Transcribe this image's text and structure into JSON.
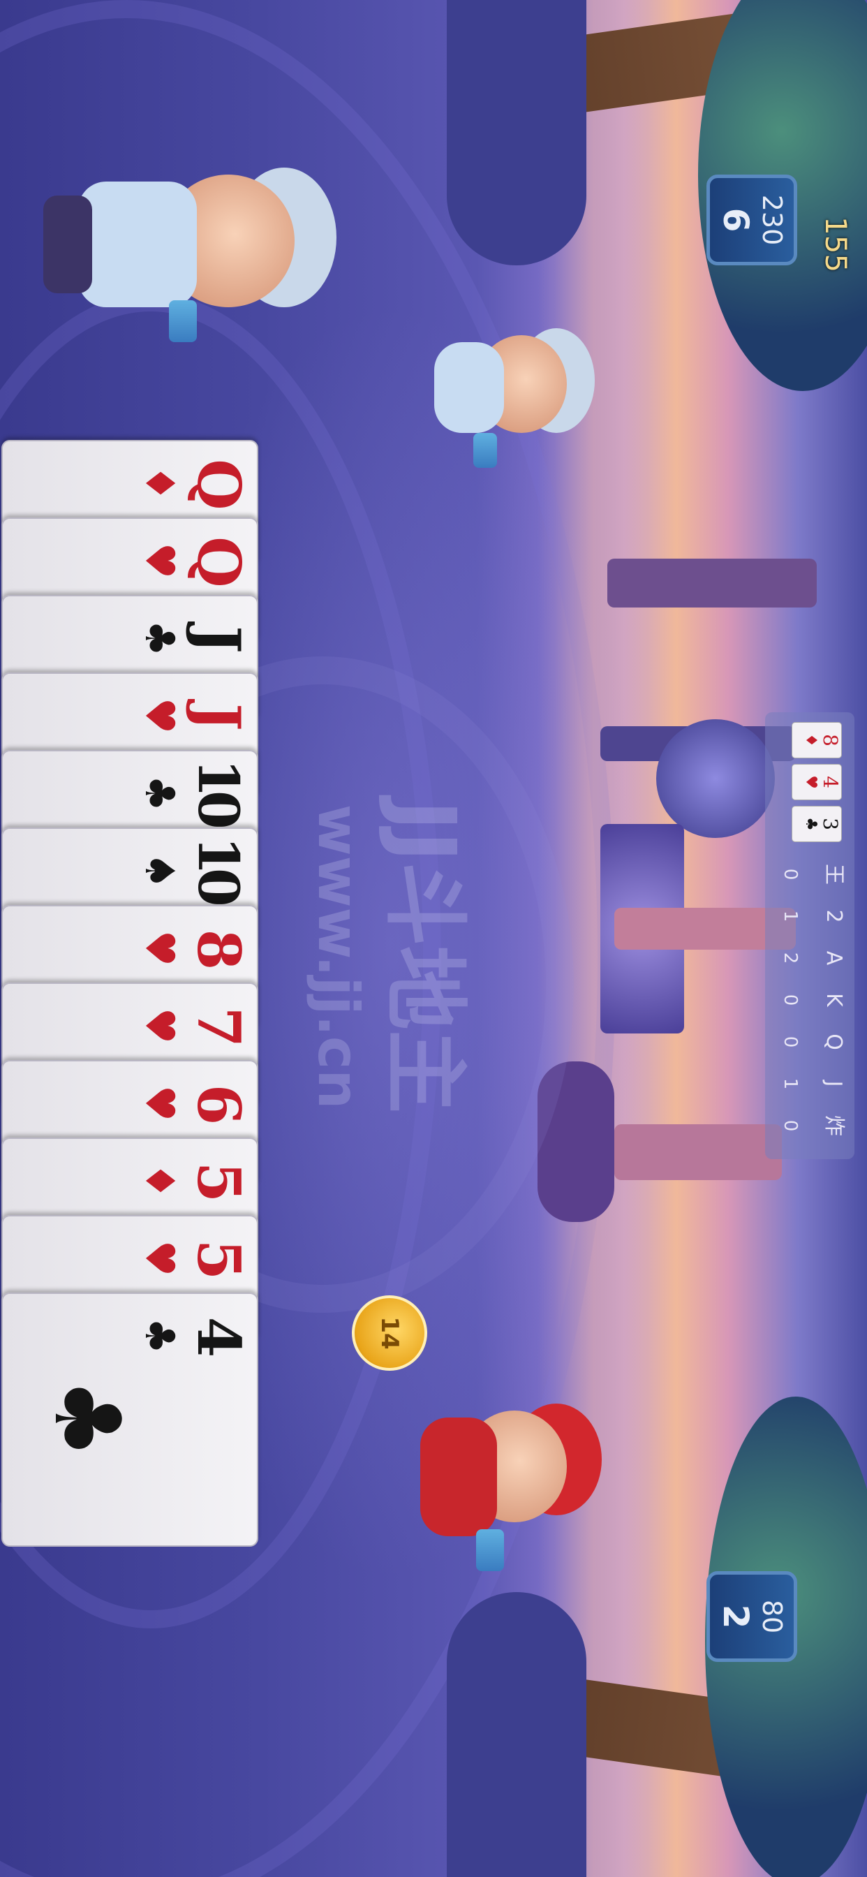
{
  "game": {
    "watermark_title": "JJ斗地主",
    "watermark_url": "www.jj.cn"
  },
  "player_coins": "155",
  "opponents": [
    {
      "name": "top-opponent",
      "score": "230",
      "cards_left": "6"
    },
    {
      "name": "bottom-opponent",
      "score": "80",
      "cards_left": "2"
    }
  ],
  "turn_timer": "14",
  "card_tracker": {
    "labels": [
      "王",
      "2",
      "A",
      "K",
      "Q",
      "J",
      "炸"
    ],
    "counts": [
      "0",
      "1",
      "2",
      "0",
      "0",
      "1",
      "0"
    ],
    "last_played": [
      {
        "rank": "8",
        "suit": "♦",
        "color": "#c51d2a"
      },
      {
        "rank": "4",
        "suit": "♥",
        "color": "#c51d2a"
      },
      {
        "rank": "3",
        "suit": "♣",
        "color": "#151515"
      }
    ]
  },
  "hand": [
    {
      "rank": "Q",
      "suit": "♦",
      "color": "red"
    },
    {
      "rank": "Q",
      "suit": "♥",
      "color": "red"
    },
    {
      "rank": "J",
      "suit": "♣",
      "color": "black"
    },
    {
      "rank": "J",
      "suit": "♥",
      "color": "red"
    },
    {
      "rank": "10",
      "suit": "♣",
      "color": "black"
    },
    {
      "rank": "10",
      "suit": "♠",
      "color": "black"
    },
    {
      "rank": "8",
      "suit": "♥",
      "color": "red"
    },
    {
      "rank": "7",
      "suit": "♥",
      "color": "red"
    },
    {
      "rank": "6",
      "suit": "♥",
      "color": "red"
    },
    {
      "rank": "5",
      "suit": "♦",
      "color": "red"
    },
    {
      "rank": "5",
      "suit": "♥",
      "color": "red"
    },
    {
      "rank": "4",
      "suit": "♣",
      "color": "black"
    }
  ],
  "colors": {
    "card_red": "#c51d2a",
    "card_black": "#151515",
    "counter_bg": "#2a5e9e",
    "timer_gold": "#e9a51a"
  }
}
